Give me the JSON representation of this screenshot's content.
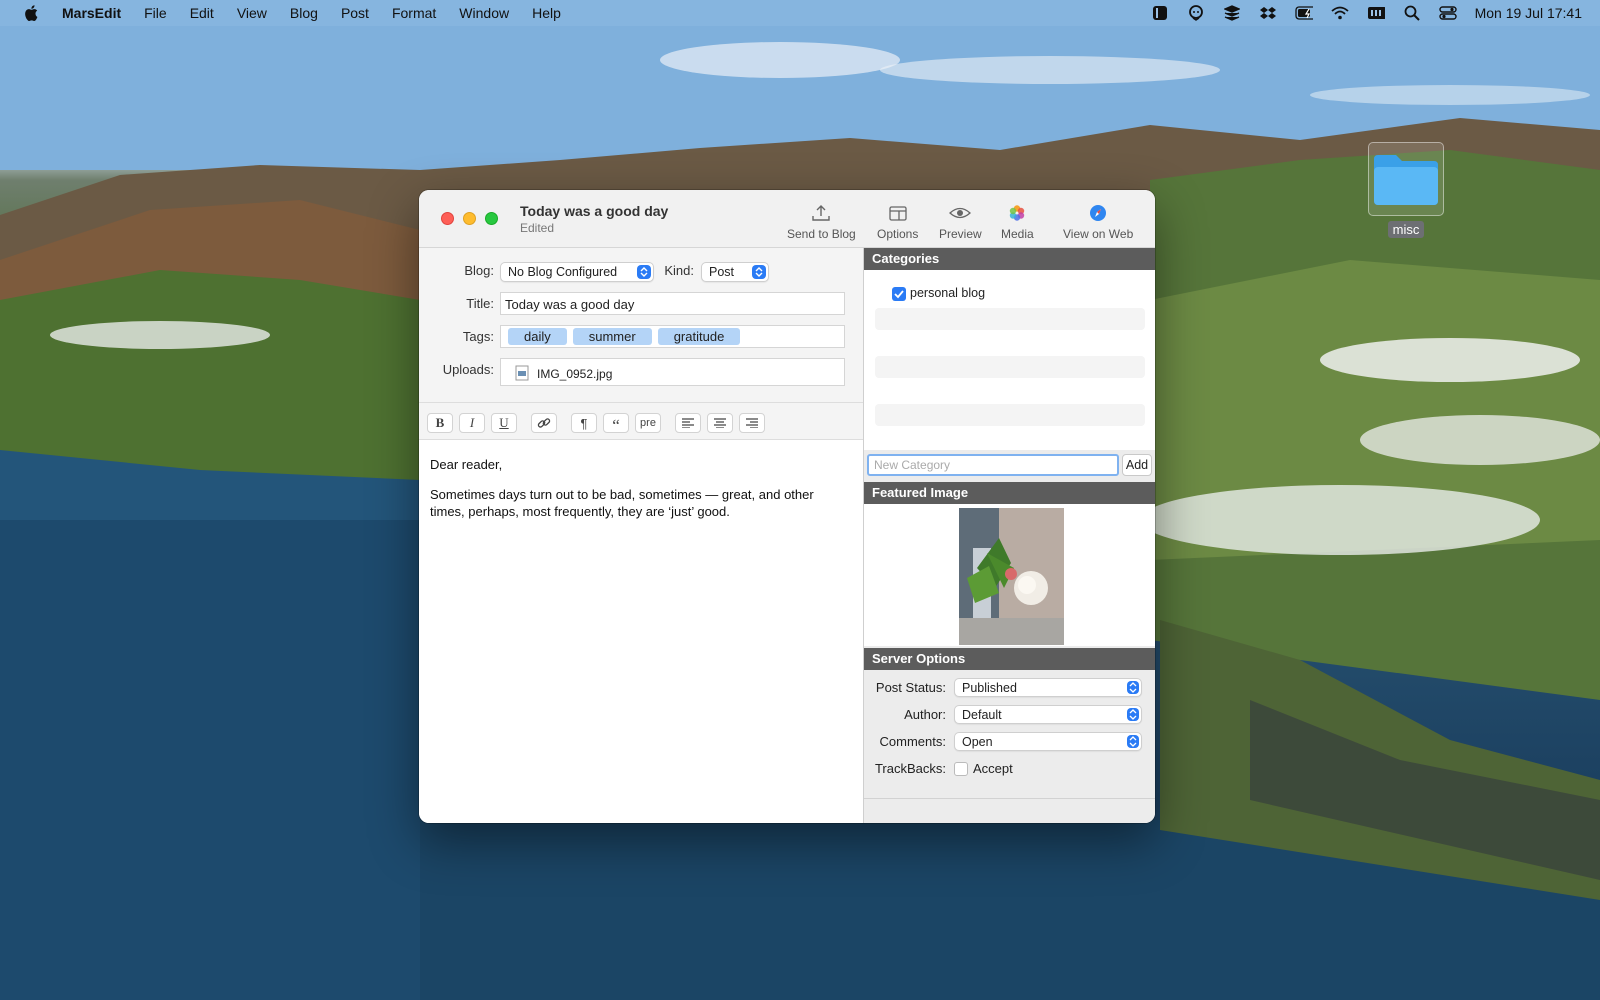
{
  "menubar": {
    "app": "MarsEdit",
    "items": [
      "File",
      "Edit",
      "View",
      "Blog",
      "Post",
      "Format",
      "Window",
      "Help"
    ],
    "clock": "Mon 19 Jul  17:41"
  },
  "desktop": {
    "folder_label": "misc"
  },
  "window": {
    "title": "Today was a good day",
    "subtitle": "Edited",
    "toolbar": {
      "send": "Send to Blog",
      "options": "Options",
      "preview": "Preview",
      "media": "Media",
      "view_on_web": "View on Web"
    },
    "meta": {
      "blog_label": "Blog:",
      "blog_value": "No Blog Configured",
      "kind_label": "Kind:",
      "kind_value": "Post",
      "title_label": "Title:",
      "title_value": "Today was a good day",
      "tags_label": "Tags:",
      "tags": [
        "daily",
        "summer",
        "gratitude"
      ],
      "uploads_label": "Uploads:",
      "upload_file": "IMG_0952.jpg"
    },
    "format_bar": {
      "bold": "B",
      "italic": "I",
      "underline": "U",
      "paragraph": "¶",
      "quote": "“",
      "pre": "pre"
    },
    "editor": {
      "line1": "Dear reader,",
      "line2": "Sometimes days turn out to be bad, sometimes — great, and other times, perhaps, most frequently, they are ‘just’ good."
    },
    "sidebar": {
      "categories_header": "Categories",
      "category": "personal blog",
      "category_checked": true,
      "new_category_placeholder": "New Category",
      "add_label": "Add",
      "featured_header": "Featured Image",
      "server_header": "Server Options",
      "post_status_label": "Post Status:",
      "post_status": "Published",
      "author_label": "Author:",
      "author": "Default",
      "comments_label": "Comments:",
      "comments": "Open",
      "trackbacks_label": "TrackBacks:",
      "trackbacks": "Accept",
      "trackbacks_checked": false
    }
  }
}
